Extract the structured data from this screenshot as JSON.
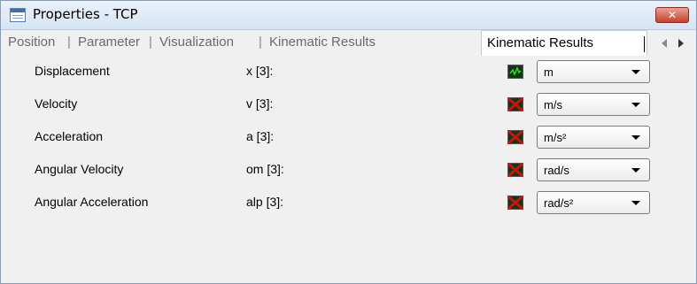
{
  "window": {
    "title": "Properties - TCP",
    "close_label": "✕"
  },
  "tabs": [
    {
      "label": "Position"
    },
    {
      "label": "Parameter"
    },
    {
      "label": "Visualization"
    },
    {
      "label": "Kinematic Results"
    }
  ],
  "tab_separator": "|",
  "active_tab": {
    "label": "Kinematic Results"
  },
  "rows": [
    {
      "label": "Displacement",
      "symbol": "x [3]:",
      "state": "monitor-active",
      "unit": "m"
    },
    {
      "label": "Velocity",
      "symbol": "v [3]:",
      "state": "disabled",
      "unit": "m/s"
    },
    {
      "label": "Acceleration",
      "symbol": "a [3]:",
      "state": "disabled",
      "unit": "m/s²"
    },
    {
      "label": "Angular Velocity",
      "symbol": "om [3]:",
      "state": "disabled",
      "unit": "rad/s"
    },
    {
      "label": "Angular Acceleration",
      "symbol": "alp [3]:",
      "state": "disabled",
      "unit": "rad/s²"
    }
  ],
  "icons": {
    "monitor-active": "plot-monitor-icon",
    "disabled": "disabled-x-icon"
  },
  "colors": {
    "monitor_green": "#2ecc2e",
    "disabled_red": "#cc1010",
    "titlebar": "#dbe7f5"
  }
}
